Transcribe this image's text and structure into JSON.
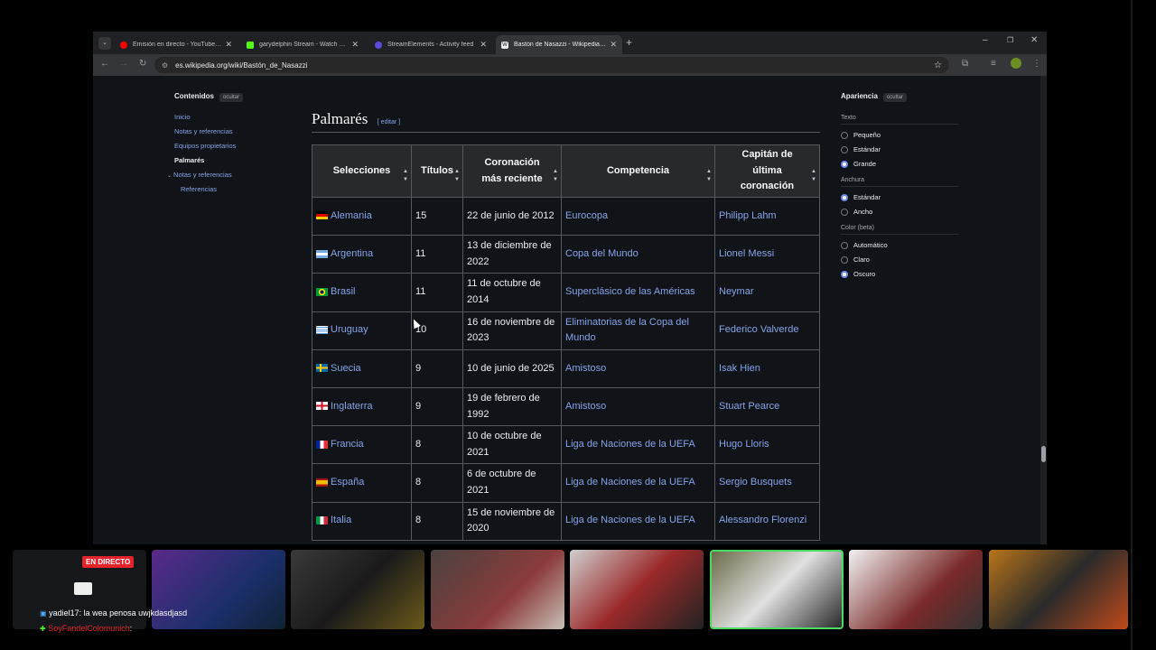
{
  "browser": {
    "tabs": [
      {
        "title": "Emisión en directo - YouTube Stu",
        "color": "#ff0000"
      },
      {
        "title": "garydelphin Stream - Watch Live",
        "color": "#53fc18"
      },
      {
        "title": "StreamElements - Activity feed",
        "color": "#5b4cde"
      },
      {
        "title": "Bastón de Nasazzi - Wikipedia, la",
        "color": "#eaecf0"
      }
    ],
    "url": "es.wikipedia.org/wiki/Bastón_de_Nasazzi"
  },
  "toc": {
    "title": "Contenidos",
    "hide": "ocultar",
    "items": [
      "Inicio",
      "Notas y referencias",
      "Equipos propietarios",
      "Palmarés",
      "Notas y referencias",
      "Referencias"
    ]
  },
  "appearance": {
    "title": "Apariencia",
    "hide": "ocultar",
    "text_label": "Texto",
    "text_options": [
      "Pequeño",
      "Estándar",
      "Grande"
    ],
    "width_label": "Anchura",
    "width_options": [
      "Estándar",
      "Ancho"
    ],
    "color_label": "Color (beta)",
    "color_options": [
      "Automático",
      "Claro",
      "Oscuro"
    ]
  },
  "section": {
    "title": "Palmarés",
    "edit": "editar"
  },
  "table": {
    "headers": [
      "Selecciones",
      "Títulos",
      "Coronación más reciente",
      "Competencia",
      "Capitán de última coronación"
    ],
    "rows": [
      {
        "team": "Alemania",
        "titles": "15",
        "date": "22 de junio de 2012",
        "comp": "Eurocopa",
        "captain": "Philipp Lahm"
      },
      {
        "team": "Argentina",
        "titles": "11",
        "date": "13 de diciembre de 2022",
        "comp": "Copa del Mundo",
        "captain": "Lionel Messi"
      },
      {
        "team": "Brasil",
        "titles": "11",
        "date": "11 de octubre de 2014",
        "comp": "Superclásico de las Américas",
        "captain": "Neymar"
      },
      {
        "team": "Uruguay",
        "titles": "10",
        "date": "16 de noviembre de 2023",
        "comp": "Eliminatorias de la Copa del Mundo",
        "captain": "Federico Valverde"
      },
      {
        "team": "Suecia",
        "titles": "9",
        "date": "10 de junio de 2025",
        "comp": "Amistoso",
        "captain": "Isak Hien"
      },
      {
        "team": "Inglaterra",
        "titles": "9",
        "date": "19 de febrero de 1992",
        "comp": "Amistoso",
        "captain": "Stuart Pearce"
      },
      {
        "team": "Francia",
        "titles": "8",
        "date": "10 de octubre de 2021",
        "comp": "Liga de Naciones de la UEFA",
        "captain": "Hugo Lloris"
      },
      {
        "team": "España",
        "titles": "8",
        "date": "6 de octubre de 2021",
        "comp": "Liga de Naciones de la UEFA",
        "captain": "Sergio Busquets"
      },
      {
        "team": "Italia",
        "titles": "8",
        "date": "15 de noviembre de 2020",
        "comp": "Liga de Naciones de la UEFA",
        "captain": "Alessandro Florenzi"
      }
    ]
  },
  "stream": {
    "live_badge": "EN DIRECTO",
    "chat": [
      {
        "user": "yadiel17",
        "text": ": la wea penosa uwjkdasdjasd",
        "color": "#ffffff"
      },
      {
        "user": "SoyFandelColomunich",
        "text": ":",
        "color": "#e6232b"
      }
    ]
  }
}
